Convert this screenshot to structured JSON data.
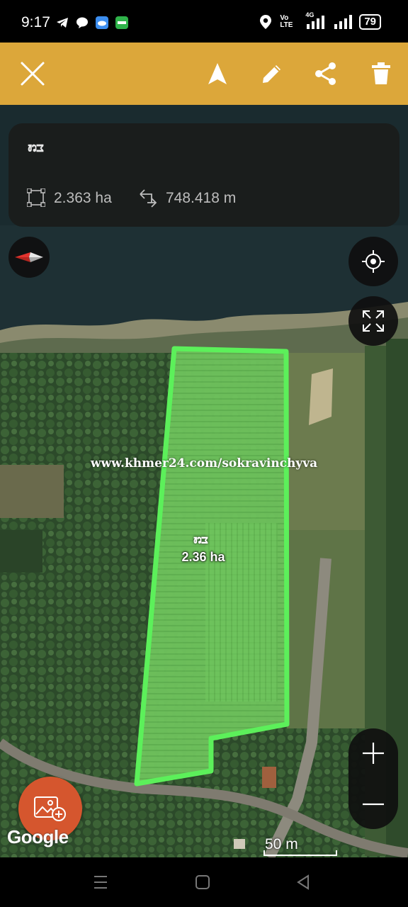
{
  "status_bar": {
    "time": "9:17",
    "network_label": "Vo LTE",
    "network_type": "4G",
    "battery": "79",
    "icons": [
      "telegram-icon",
      "chat-icon",
      "cloud-app-icon",
      "smart-app-icon",
      "location-icon",
      "signal-icon",
      "signal-icon",
      "battery-icon"
    ]
  },
  "toolbar": {
    "buttons": [
      "close-icon",
      "navigate-icon",
      "edit-icon",
      "share-icon",
      "delete-icon"
    ],
    "color": "#dca73a"
  },
  "info_card": {
    "title": "ដី",
    "area": "2.363 ha",
    "perimeter": "748.418 m"
  },
  "map": {
    "watermark": "www.khmer24.com/sokravinchyva",
    "polygon_name": "ដី",
    "polygon_area": "2.36 ha",
    "polygon_color": "#5cf05a",
    "attribution": "Google",
    "scale_label": "50 m",
    "controls": {
      "compass": "compass-icon",
      "my_location": "my-location-icon",
      "fit": "fit-bounds-icon",
      "zoom_in": "+",
      "zoom_out": "−",
      "add_photo": "add-photo-icon"
    }
  },
  "nav_bar": {
    "buttons": [
      "recents-icon",
      "home-icon",
      "back-icon"
    ]
  }
}
